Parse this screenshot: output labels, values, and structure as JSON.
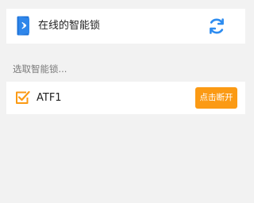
{
  "header": {
    "title": "在线的智能锁",
    "logo_icon": "bluetooth-lock-icon",
    "refresh_icon": "refresh-icon"
  },
  "section": {
    "label": "选取智能锁..."
  },
  "devices": [
    {
      "name": "ATF1",
      "selected": true,
      "action_label": "点击断开",
      "check_icon": "checkbox-checked-icon"
    }
  ],
  "colors": {
    "accent_orange": "#FB9A14",
    "refresh_blue": "#2D8CF0",
    "logo_blue": "#1E73D8",
    "background": "#F2F2F2"
  }
}
